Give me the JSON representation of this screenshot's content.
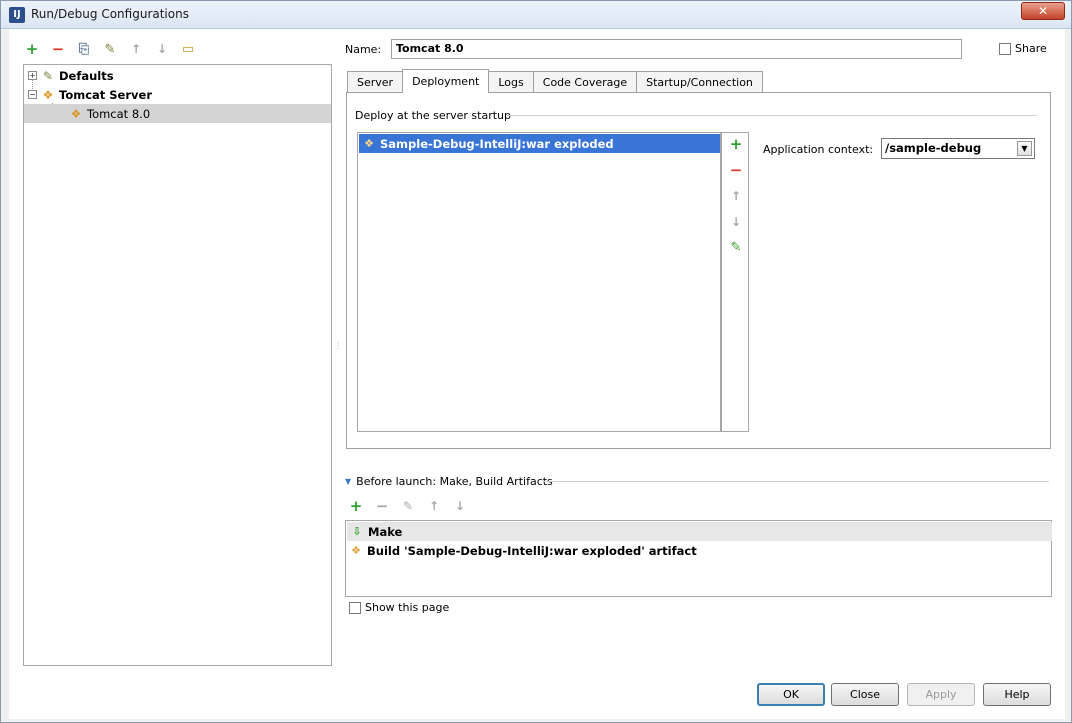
{
  "window": {
    "title": "Run/Debug Configurations",
    "close_label": "✕"
  },
  "left_toolbar": {
    "add": "+",
    "remove": "−",
    "copy": "⎘",
    "edit_defaults": "✎",
    "move_up": "↑",
    "move_down": "↓",
    "folder": "▭"
  },
  "tree": {
    "defaults": "Defaults",
    "tomcat_server": "Tomcat Server",
    "tomcat_80": "Tomcat 8.0"
  },
  "form": {
    "name_label": "Name:",
    "name_value": "Tomcat 8.0",
    "share_label": "Share"
  },
  "tabs": [
    "Server",
    "Deployment",
    "Logs",
    "Code Coverage",
    "Startup/Connection"
  ],
  "deployment": {
    "section_title": "Deploy at the server startup",
    "items": [
      "Sample-Debug-IntelliJ:war exploded"
    ],
    "app_context_label": "Application context:",
    "app_context_value": "/sample-debug"
  },
  "before_launch": {
    "header": "Before launch: Make, Build Artifacts",
    "items": [
      "Make",
      "Build 'Sample-Debug-IntelliJ:war exploded' artifact"
    ]
  },
  "show_page_label": "Show this page",
  "buttons": {
    "ok": "OK",
    "close": "Close",
    "apply": "Apply",
    "help": "Help"
  },
  "colors": {
    "selection": "#3875d7",
    "add_green": "#2ea12e",
    "remove_red": "#d6382c"
  }
}
